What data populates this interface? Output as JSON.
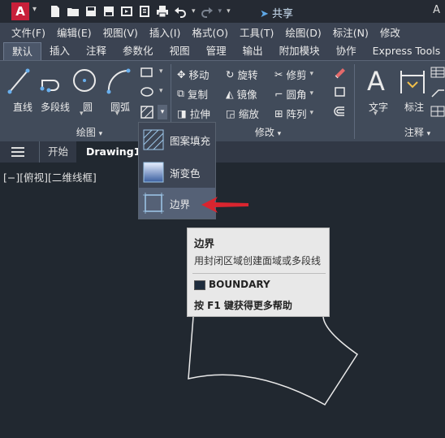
{
  "qat": {
    "app_letter": "A",
    "share_label": "共享",
    "right_letter": "A"
  },
  "menubar": {
    "items": [
      "文件(F)",
      "编辑(E)",
      "视图(V)",
      "插入(I)",
      "格式(O)",
      "工具(T)",
      "绘图(D)",
      "标注(N)",
      "修改"
    ]
  },
  "tabs": {
    "items": [
      "默认",
      "插入",
      "注释",
      "参数化",
      "视图",
      "管理",
      "输出",
      "附加模块",
      "协作",
      "Express Tools"
    ],
    "active_index": 0
  },
  "ribbon": {
    "draw_tools": [
      "直线",
      "多段线",
      "圆",
      "圆弧"
    ],
    "draw_panel_label": "绘图",
    "modify_rows": [
      [
        "移动",
        "旋转",
        "修剪"
      ],
      [
        "复制",
        "镜像",
        "圆角"
      ],
      [
        "拉伸",
        "缩放",
        "阵列"
      ]
    ],
    "modify_panel_label": "修改",
    "annotate_tools": [
      "文字",
      "标注"
    ],
    "annotate_panel_label": "注释"
  },
  "doc_tabs": {
    "start_label": "开始",
    "current_label": "Drawing1*"
  },
  "viewport": {
    "label": "[−][俯视][二维线框]"
  },
  "dropdown": {
    "items": [
      "图案填充",
      "渐变色",
      "边界"
    ],
    "selected_index": 2
  },
  "tooltip": {
    "title": "边界",
    "description": "用封闭区域创建面域或多段线",
    "command": "BOUNDARY",
    "help": "按 F1 键获得更多帮助"
  },
  "colors": {
    "canvas": "#212830",
    "arrow": "#d9252f",
    "app_red": "#c8203a"
  }
}
